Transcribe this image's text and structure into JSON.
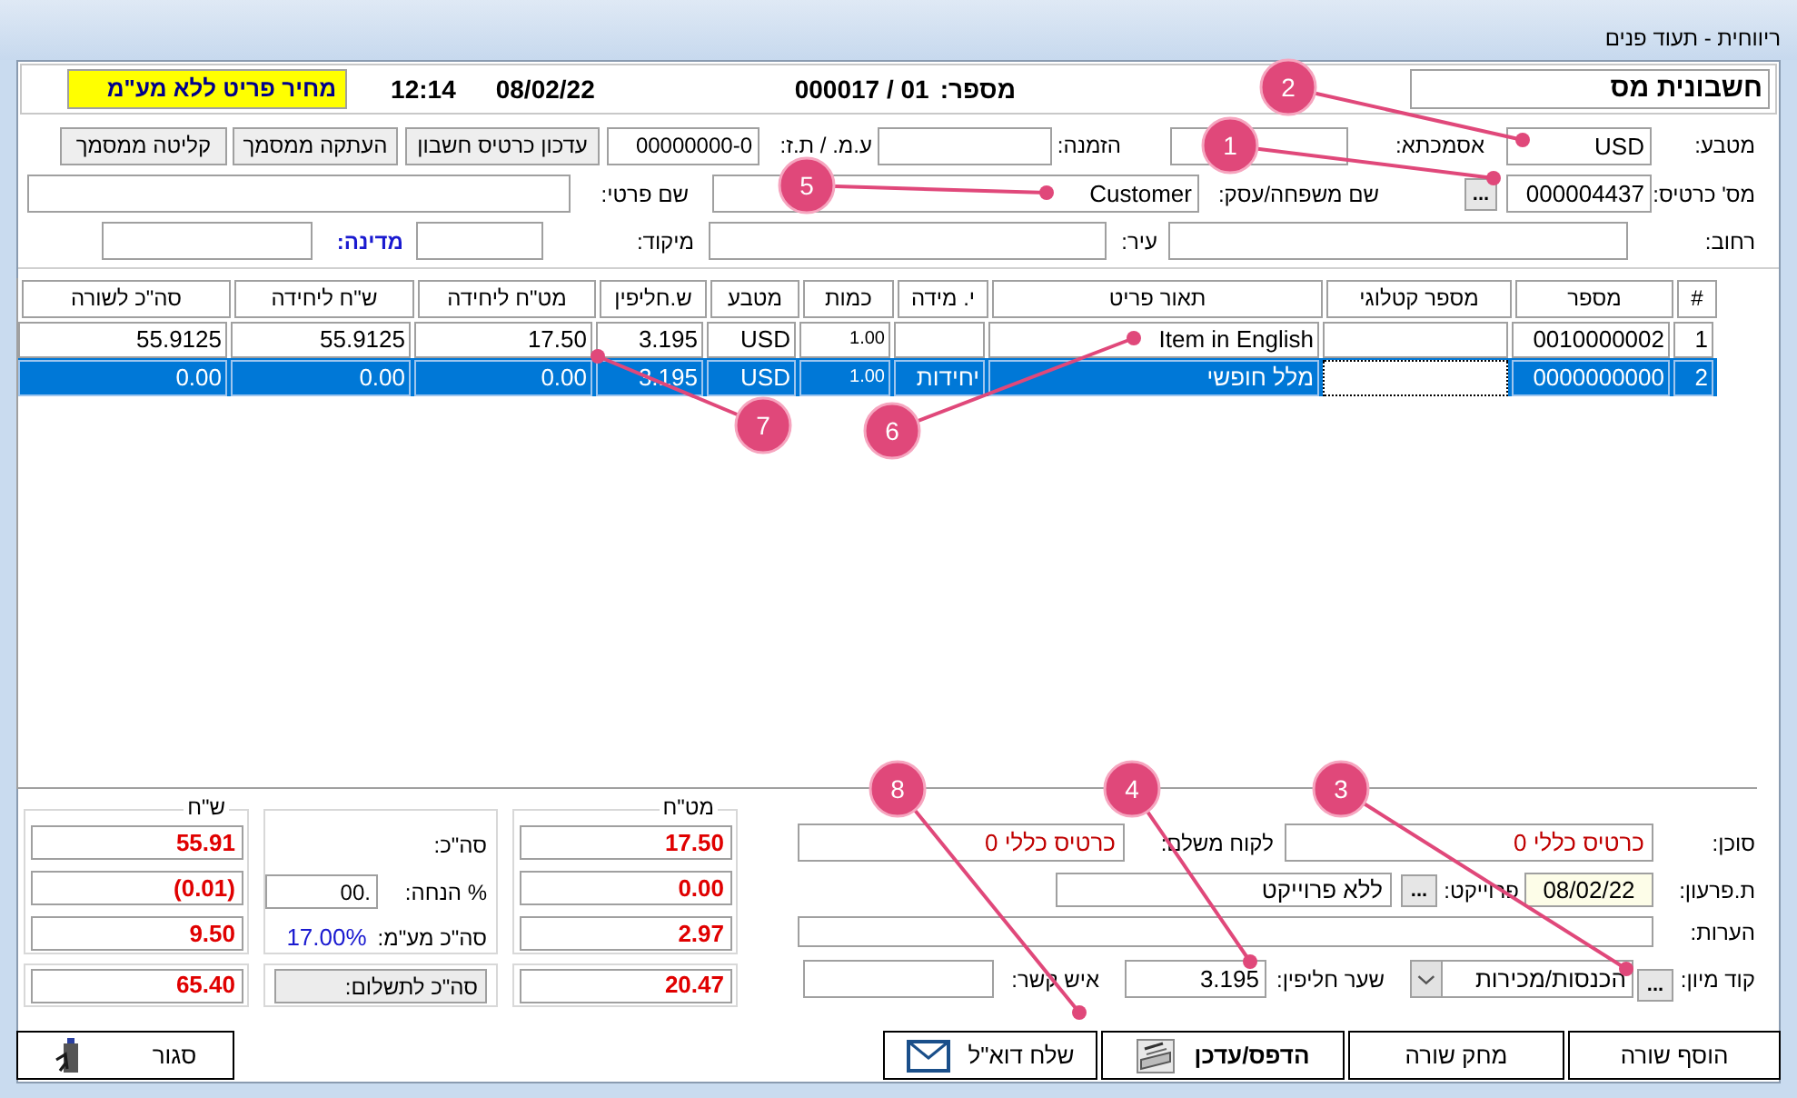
{
  "window": {
    "title": "ריווחית - תעוד פנים"
  },
  "header": {
    "doc_type": "חשבונית מס",
    "number_label": "מספר:",
    "number": "000017 / 01",
    "date": "08/02/22",
    "time": "12:14",
    "price_mode": "מחיר פריט ללא מע\"מ"
  },
  "customer": {
    "currency_label": "מטבע:",
    "currency": "USD",
    "reference_label": "אסמכתא:",
    "order_label": "הזמנה:",
    "tax_id_label": "ע.מ. / ת.ז:",
    "tax_id": "00000000-0",
    "card_label": "מס' כרטיס:",
    "card": "000004437",
    "browse_button": "...",
    "last_name_label": "שם משפחה/עסק:",
    "last_name": "Customer",
    "first_name_label": "שם פרטי:",
    "street_label": "רחוב:",
    "city_label": "עיר:",
    "zip_label": "מיקוד:",
    "country_label": "מדינה:"
  },
  "header_buttons": [
    "עדכון כרטיס חשבון",
    "העתקה ממסמך",
    "קליטה ממסמך"
  ],
  "table": {
    "columns": [
      {
        "label": "#"
      },
      {
        "label": "מספר"
      },
      {
        "label": "מספר קטלוגי"
      },
      {
        "label": "תאור פריט"
      },
      {
        "label": "י. מידה"
      },
      {
        "label": "כמות"
      },
      {
        "label": "מטבע"
      },
      {
        "label": "ש.חליפין"
      },
      {
        "label": "מט\"ח ליחידה"
      },
      {
        "label": "ש\"ח ליחידה"
      },
      {
        "label": "סה\"כ לשורה"
      }
    ],
    "rows": [
      {
        "index": "1",
        "number": "0010000002",
        "description": "Item in English",
        "quantity": "1.00",
        "currency": "USD",
        "rate": "3.195",
        "fx_price": "17.50",
        "nis_price": "55.9125",
        "line_total": "55.9125",
        "selected": false,
        "catalog_focused": false
      },
      {
        "index": "2",
        "number": "0000000000",
        "description": "מלל חופשי",
        "unit": "יחידות",
        "quantity": "1.00",
        "currency": "USD",
        "rate": "3.195",
        "fx_price": "0.00",
        "nis_price": "0.00",
        "line_total": "0.00",
        "selected": true,
        "catalog_focused": true
      }
    ]
  },
  "details": {
    "agent_label": "סוכן:",
    "agent": "כרטיס כללי 0",
    "payer_label": "לקוח משלם:",
    "payer": "כרטיס כללי 0",
    "due_label": "ת.פרעון:",
    "due": "08/02/22",
    "project_label": "פרוייקט:",
    "project_button": "...",
    "project": "ללא פרוייקט",
    "notes_label": "הערות:",
    "sort_label": "קוד מיון:",
    "sort_button": "...",
    "sort": "הכנסות/מכירות",
    "rate_label": "שער חליפין:",
    "rate": "3.195",
    "contact_label": "איש קשר:"
  },
  "totals": {
    "fx_label": "מט\"ח",
    "nis_label": "ש\"ח",
    "fx": [
      "17.50",
      "0.00",
      "2.97",
      "20.47"
    ],
    "nis": [
      "55.91",
      "(0.01)",
      "9.50",
      "65.40"
    ],
    "subtotal_label": "סה\"כ:",
    "discount_label": "% הנחה:",
    "discount": ".00",
    "vat_label": "סה\"כ מע\"מ:",
    "vat_rate": "17.00%",
    "total_button": "סה\"כ לתשלום:"
  },
  "buttons": [
    {
      "label": "הוסף שורה",
      "kind": "plain"
    },
    {
      "label": "מחק שורה",
      "kind": "plain"
    },
    {
      "label": "הדפס/עדכן",
      "kind": "print"
    },
    {
      "label": "שלח דוא\"ל",
      "kind": "email"
    }
  ],
  "close_button": {
    "label": "סגור"
  },
  "callouts": [
    {
      "number": "1"
    },
    {
      "number": "2"
    },
    {
      "number": "3"
    },
    {
      "number": "4"
    },
    {
      "number": "5"
    },
    {
      "number": "6"
    },
    {
      "number": "7"
    },
    {
      "number": "8"
    }
  ]
}
